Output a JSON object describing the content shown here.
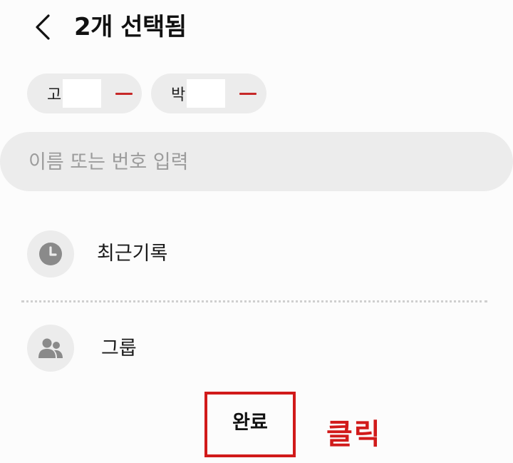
{
  "header": {
    "back_icon": "chevron-left-icon",
    "title": "2개 선택됨"
  },
  "selected_chips": [
    {
      "name": "고",
      "remove_icon": "minus-icon"
    },
    {
      "name": "박",
      "remove_icon": "minus-icon"
    }
  ],
  "search": {
    "placeholder": "이름 또는 번호 입력",
    "value": ""
  },
  "list": [
    {
      "icon": "clock-icon",
      "label": "최근기록"
    },
    {
      "icon": "people-icon",
      "label": "그룹"
    }
  ],
  "footer": {
    "done_label": "완료",
    "annotation": "클릭",
    "annotation_color": "#d11a1a"
  },
  "colors": {
    "remove_accent": "#c62828",
    "chip_background": "#ececec",
    "icon_gray": "#8a8a8a"
  }
}
